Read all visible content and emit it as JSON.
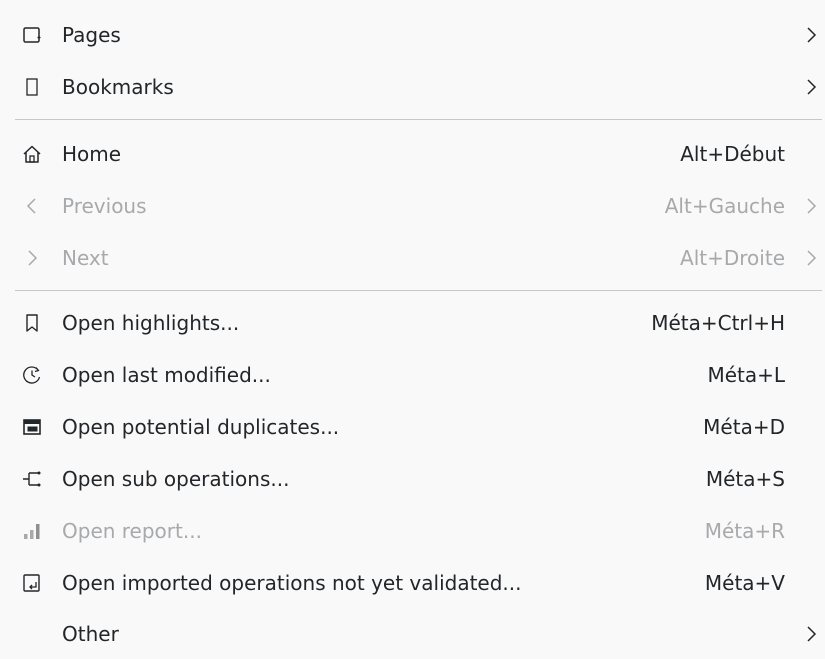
{
  "menu": {
    "items": [
      {
        "label": "Pages",
        "shortcut": "",
        "icon": "pages-icon",
        "submenu": true,
        "enabled": true
      },
      {
        "label": "Bookmarks",
        "shortcut": "",
        "icon": "bookmark-icon",
        "submenu": true,
        "enabled": true
      },
      {
        "label": "Home",
        "shortcut": "Alt+Début",
        "icon": "home-icon",
        "submenu": false,
        "enabled": true
      },
      {
        "label": "Previous",
        "shortcut": "Alt+Gauche",
        "icon": "chevron-left-icon",
        "submenu": true,
        "enabled": false
      },
      {
        "label": "Next",
        "shortcut": "Alt+Droite",
        "icon": "chevron-right-icon",
        "submenu": true,
        "enabled": false
      },
      {
        "label": "Open highlights...",
        "shortcut": "Méta+Ctrl+H",
        "icon": "highlight-bookmark-icon",
        "submenu": false,
        "enabled": true
      },
      {
        "label": "Open last modified...",
        "shortcut": "Méta+L",
        "icon": "history-icon",
        "submenu": false,
        "enabled": true
      },
      {
        "label": "Open potential duplicates...",
        "shortcut": "Méta+D",
        "icon": "duplicates-icon",
        "submenu": false,
        "enabled": true
      },
      {
        "label": "Open sub operations...",
        "shortcut": "Méta+S",
        "icon": "split-icon",
        "submenu": false,
        "enabled": true
      },
      {
        "label": "Open report...",
        "shortcut": "Méta+R",
        "icon": "report-bars-icon",
        "submenu": false,
        "enabled": false
      },
      {
        "label": "Open imported operations not yet validated...",
        "shortcut": "Méta+V",
        "icon": "import-document-icon",
        "submenu": false,
        "enabled": true
      },
      {
        "label": "Other",
        "shortcut": "",
        "icon": "",
        "submenu": true,
        "enabled": true
      }
    ]
  },
  "colors": {
    "background": "#f9f9fa",
    "text": "#232629",
    "disabled_text": "#a7a9ab",
    "separator": "#c5c7c9"
  }
}
